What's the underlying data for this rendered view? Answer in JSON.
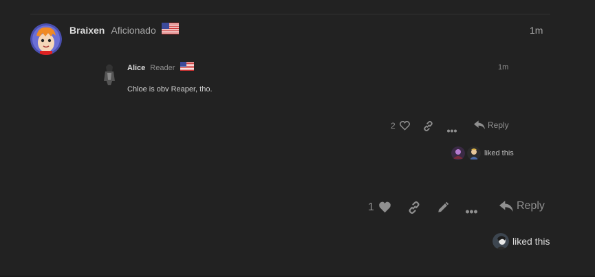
{
  "post": {
    "author": "Braixen",
    "author_title": "Aficionado",
    "time": "1m",
    "like_count": "1",
    "reply_label": "Reply",
    "liked_text": "liked this"
  },
  "quote": {
    "author": "Alice",
    "author_title": "Reader",
    "time": "1m",
    "body": "Chloe is obv Reaper, tho.",
    "like_count": "2",
    "reply_label": "Reply",
    "liked_text": "liked this"
  },
  "colors": {
    "background": "#222222",
    "text": "#dddddd",
    "muted": "#8f8f8f"
  },
  "icons": {
    "heart_outline": "heart-outline-icon",
    "heart": "heart-icon",
    "link": "link-icon",
    "more": "ellipsis-icon",
    "reply": "reply-arrow-icon",
    "edit": "pencil-icon",
    "flag": "us-flag-icon"
  }
}
